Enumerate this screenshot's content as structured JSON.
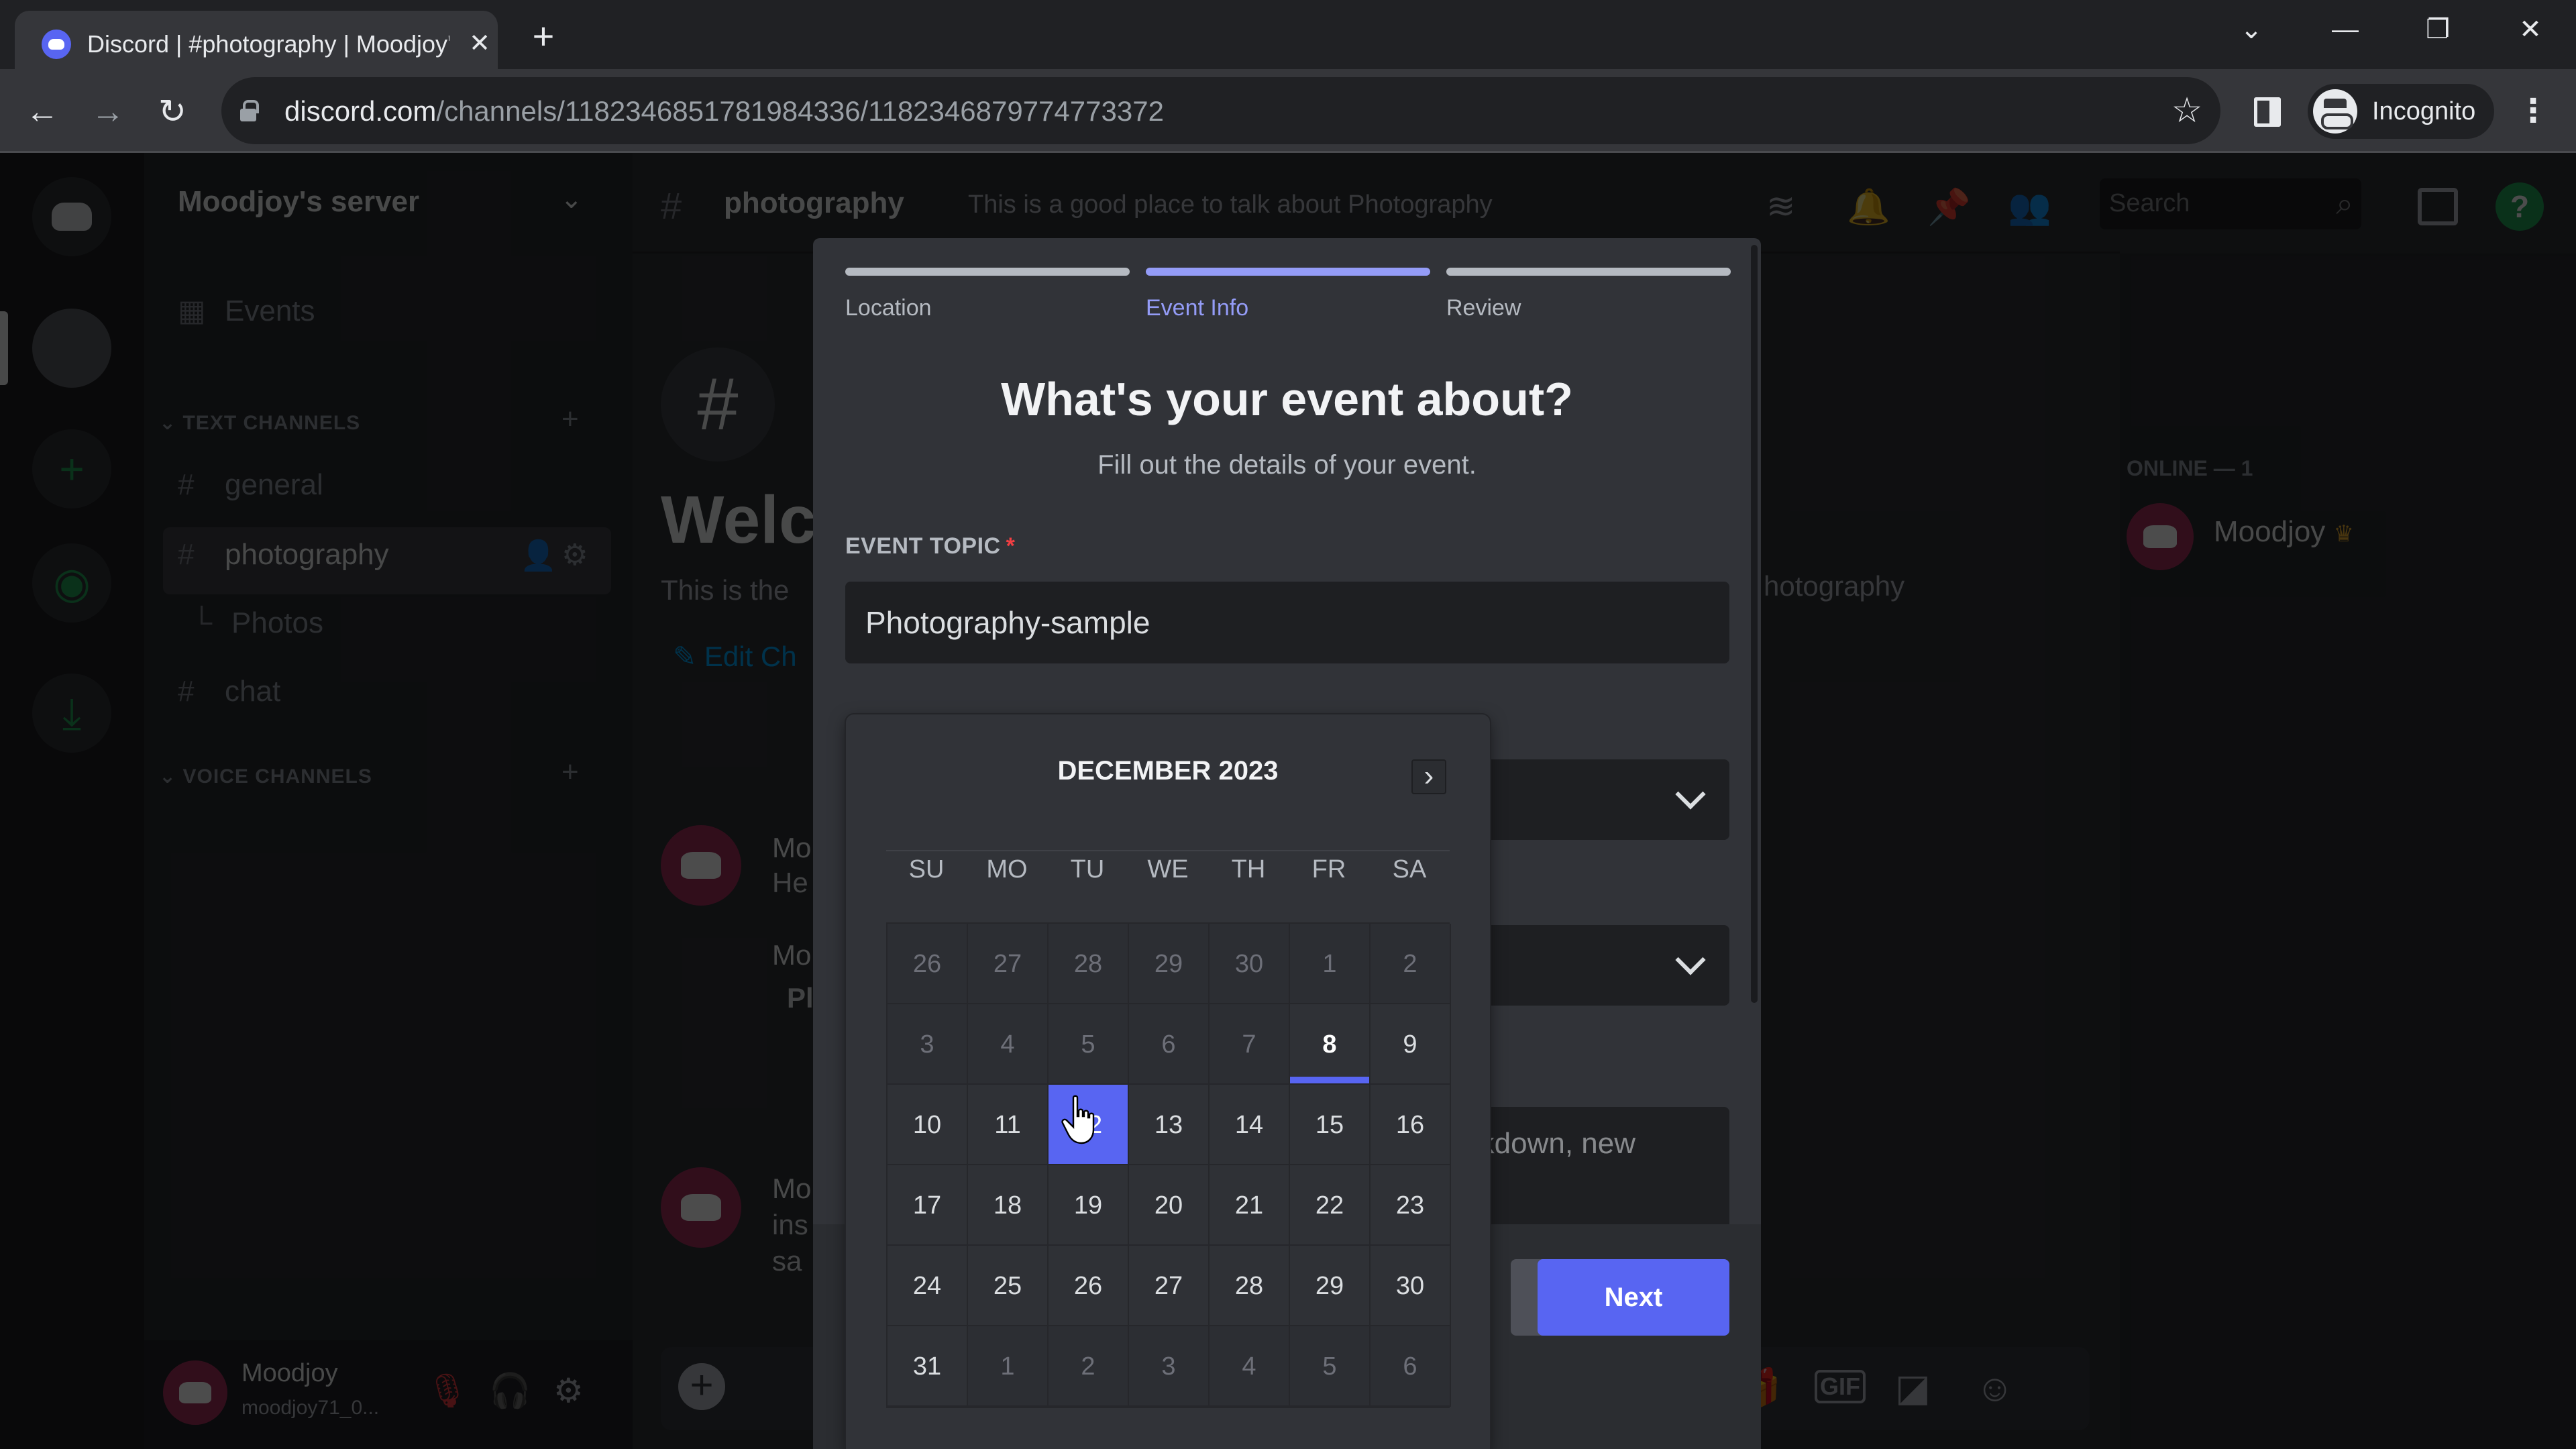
{
  "browser": {
    "tab_title": "Discord | #photography | Moodjoy's server",
    "url_host": "discord.com",
    "url_path": "/channels/1182346851781984336/1182346879774773372",
    "profile_label": "Incognito",
    "icons": {
      "back": "back-arrow-icon",
      "forward": "forward-arrow-icon",
      "reload": "reload-icon",
      "star": "star-icon",
      "tab_close": "close-icon",
      "new_tab": "plus-icon"
    },
    "glyphs": {
      "back": "←",
      "forward": "→",
      "reload": "↻",
      "star": "☆",
      "close": "✕",
      "new_tab": "+",
      "tab_search": "⌄",
      "minimize": "—",
      "restore": "❐",
      "window_close": "✕",
      "menu": "⋮"
    }
  },
  "discord": {
    "server_name": "Moodjoy's server",
    "sidebar": {
      "events_label": "Events",
      "text_category": "TEXT CHANNELS",
      "voice_category": "VOICE CHANNELS",
      "channels": [
        {
          "name": "general",
          "type": "text"
        },
        {
          "name": "photography",
          "type": "text",
          "selected": true
        },
        {
          "name": "Photos",
          "type": "thread"
        },
        {
          "name": "chat",
          "type": "text"
        }
      ]
    },
    "user": {
      "display_name": "Moodjoy",
      "username": "moodjoy71_0..."
    },
    "channel_header": {
      "name": "photography",
      "topic": "This is a good place to talk about Photography",
      "search_placeholder": "Search"
    },
    "chat": {
      "welcome_partial": "Welco",
      "welcome_sub_partial": "This is the",
      "edit_channel_partial": "Edit Ch",
      "topic_tail": "hotography",
      "messages": [
        {
          "author_partial": "Mo",
          "text_partial": "He"
        },
        {
          "author_partial": "Mo",
          "text_partial": "Pl"
        },
        {
          "author_partial": "Mo",
          "text_partial": "ins",
          "text2_partial": "sa"
        }
      ]
    },
    "members": {
      "online_header": "ONLINE — 1",
      "list": [
        {
          "name": "Moodjoy",
          "owner": true
        }
      ]
    }
  },
  "modal": {
    "steps": [
      {
        "label": "Location",
        "active": false
      },
      {
        "label": "Event Info",
        "active": true
      },
      {
        "label": "Review",
        "active": false
      }
    ],
    "title": "What's your event about?",
    "subtitle": "Fill out the details of your event.",
    "topic_label": "EVENT TOPIC",
    "required_mark": "*",
    "topic_value": "Photography-sample",
    "description_visible_text": "kdown, new",
    "next_label": "Next"
  },
  "calendar": {
    "month_label": "DECEMBER 2023",
    "next_month_glyph": "›",
    "weekdays": [
      "SU",
      "MO",
      "TU",
      "WE",
      "TH",
      "FR",
      "SA"
    ],
    "today": 8,
    "selected": 12,
    "weeks": [
      [
        {
          "d": "26",
          "m": true
        },
        {
          "d": "27",
          "m": true
        },
        {
          "d": "28",
          "m": true
        },
        {
          "d": "29",
          "m": true
        },
        {
          "d": "30",
          "m": true
        },
        {
          "d": "1",
          "m": true
        },
        {
          "d": "2",
          "m": true
        }
      ],
      [
        {
          "d": "3",
          "m": true
        },
        {
          "d": "4",
          "m": true
        },
        {
          "d": "5",
          "m": true
        },
        {
          "d": "6",
          "m": true
        },
        {
          "d": "7",
          "m": true
        },
        {
          "d": "8",
          "t": true
        },
        {
          "d": "9"
        }
      ],
      [
        {
          "d": "10"
        },
        {
          "d": "11"
        },
        {
          "d": "12",
          "s": true
        },
        {
          "d": "13"
        },
        {
          "d": "14"
        },
        {
          "d": "15"
        },
        {
          "d": "16"
        }
      ],
      [
        {
          "d": "17"
        },
        {
          "d": "18"
        },
        {
          "d": "19"
        },
        {
          "d": "20"
        },
        {
          "d": "21"
        },
        {
          "d": "22"
        },
        {
          "d": "23"
        }
      ],
      [
        {
          "d": "24"
        },
        {
          "d": "25"
        },
        {
          "d": "26"
        },
        {
          "d": "27"
        },
        {
          "d": "28"
        },
        {
          "d": "29"
        },
        {
          "d": "30"
        }
      ],
      [
        {
          "d": "31"
        },
        {
          "d": "1",
          "m": true
        },
        {
          "d": "2",
          "m": true
        },
        {
          "d": "3",
          "m": true
        },
        {
          "d": "4",
          "m": true
        },
        {
          "d": "5",
          "m": true
        },
        {
          "d": "6",
          "m": true
        }
      ]
    ]
  },
  "colors": {
    "accent": "#5865f2",
    "accent_light": "#949cf7",
    "required": "#f23f43"
  }
}
